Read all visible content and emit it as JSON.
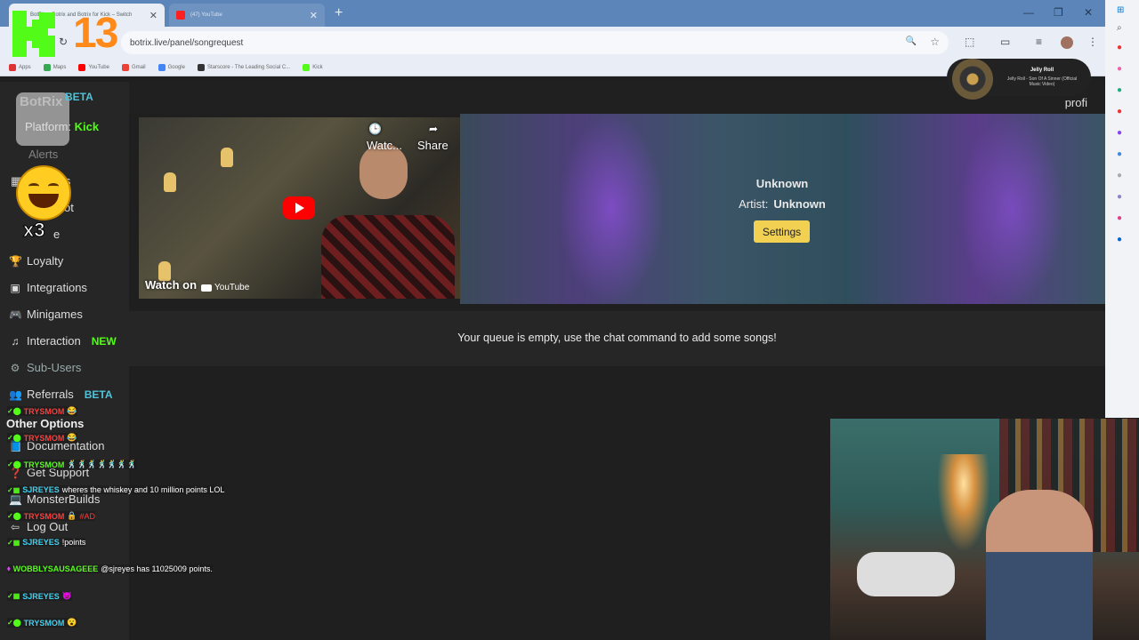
{
  "overlay": {
    "counter": "13",
    "multiplier": "x3"
  },
  "browser": {
    "tabs": [
      {
        "title": "BotRix – Botrix and Botrix for Kick – Switch",
        "active": true
      },
      {
        "title": "(47) YouTube",
        "active": false
      }
    ],
    "url": "botrix.live/panel/songrequest",
    "bookmarks": [
      "Apps",
      "Maps",
      "YouTube",
      "Gmail",
      "Google",
      "Starscore - The Leading Social C...",
      "Kick"
    ]
  },
  "now_playing": {
    "title": "Jelly Roll",
    "subtitle": "Jelly Roll - Son Of A Sinner (Official Music Video)"
  },
  "header": {
    "profile_partial": "profi"
  },
  "sidebar": {
    "brand": "BotRix",
    "beta": "BETA",
    "platform_label": "Platform:",
    "platform_value": "Kick",
    "partial_items": [
      "Alerts",
      "ets",
      "ot",
      "e"
    ],
    "items": [
      {
        "label": "Loyalty"
      },
      {
        "label": "Integrations"
      },
      {
        "label": "Minigames"
      },
      {
        "label": "Interaction",
        "tag": "NEW"
      },
      {
        "label": "Sub-Users"
      },
      {
        "label": "Referrals",
        "tag": "BETA"
      }
    ],
    "other_heading": "Other Options",
    "other_items": [
      {
        "label": "Documentation"
      },
      {
        "label": "Get Support"
      },
      {
        "label": "MonsterBuilds"
      },
      {
        "label": "Log Out"
      }
    ]
  },
  "player": {
    "watch_later": "Watc...",
    "share": "Share",
    "watch_on": "Watch on",
    "youtube": "YouTube"
  },
  "song": {
    "title": "Unknown",
    "artist_label": "Artist:",
    "artist_value": "Unknown",
    "settings_label": "Settings"
  },
  "queue": {
    "empty_message": "Your queue is empty, use the chat command to add some songs!"
  },
  "chat": [
    {
      "user": "TRYSMOM",
      "msg": "",
      "color": "#ff3b3b"
    },
    {
      "user": "TRYSMOM",
      "msg": "",
      "color": "#ff3b3b"
    },
    {
      "user": "TRYSMOM",
      "msg": "",
      "color": "#53fc18"
    },
    {
      "user": "SJREYES",
      "msg": "wheres the whiskey and 10 million points LOL",
      "color": "#3fd0f0"
    },
    {
      "user": "TRYSMOM",
      "msg": "#AD",
      "color": "#ff3b3b"
    },
    {
      "user": "SJREYES",
      "msg": "!points",
      "color": "#3fd0f0"
    },
    {
      "user": "WOBBLYSAUSAGEEE",
      "msg": "@sjreyes has 11025009 points.",
      "color": "#53fc18"
    },
    {
      "user": "SJREYES",
      "msg": "",
      "color": "#3fd0f0"
    },
    {
      "user": "TRYSMOM",
      "msg": "",
      "color": "#3fd0f0"
    }
  ]
}
